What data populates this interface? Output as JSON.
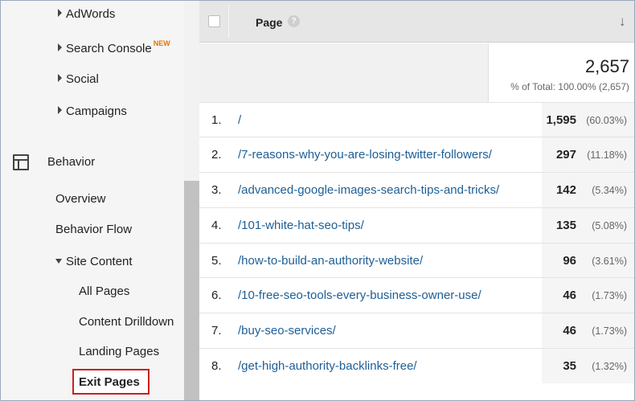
{
  "sidebar": {
    "adwords": "AdWords",
    "search_console": "Search Console",
    "search_console_badge": "NEW",
    "social": "Social",
    "campaigns": "Campaigns",
    "behavior": "Behavior",
    "overview": "Overview",
    "behavior_flow": "Behavior Flow",
    "site_content": "Site Content",
    "all_pages": "All Pages",
    "content_drilldown": "Content Drilldown",
    "landing_pages": "Landing Pages",
    "exit_pages": "Exit Pages"
  },
  "table": {
    "header_page": "Page",
    "help_glyph": "?",
    "sort_glyph": "↓",
    "total_value": "2,657",
    "total_pct": "% of Total: 100.00% (2,657)",
    "rows": [
      {
        "idx": "1.",
        "page": "/",
        "value": "1,595",
        "pct": "(60.03%)"
      },
      {
        "idx": "2.",
        "page": "/7-reasons-why-you-are-losing-twitter-followers/",
        "value": "297",
        "pct": "(11.18%)"
      },
      {
        "idx": "3.",
        "page": "/advanced-google-images-search-tips-and-tricks/",
        "value": "142",
        "pct": "(5.34%)"
      },
      {
        "idx": "4.",
        "page": "/101-white-hat-seo-tips/",
        "value": "135",
        "pct": "(5.08%)"
      },
      {
        "idx": "5.",
        "page": "/how-to-build-an-authority-website/",
        "value": "96",
        "pct": "(3.61%)"
      },
      {
        "idx": "6.",
        "page": "/10-free-seo-tools-every-business-owner-use/",
        "value": "46",
        "pct": "(1.73%)"
      },
      {
        "idx": "7.",
        "page": "/buy-seo-services/",
        "value": "46",
        "pct": "(1.73%)"
      },
      {
        "idx": "8.",
        "page": "/get-high-authority-backlinks-free/",
        "value": "35",
        "pct": "(1.32%)"
      }
    ]
  },
  "colors": {
    "link": "#1d5e96",
    "highlight_border": "#cc1f1f",
    "new_badge": "#e37400"
  },
  "icons": [
    "caret-right-icon",
    "caret-down-icon",
    "behavior-icon",
    "help-icon",
    "sort-arrow-icon",
    "checkbox-icon"
  ]
}
